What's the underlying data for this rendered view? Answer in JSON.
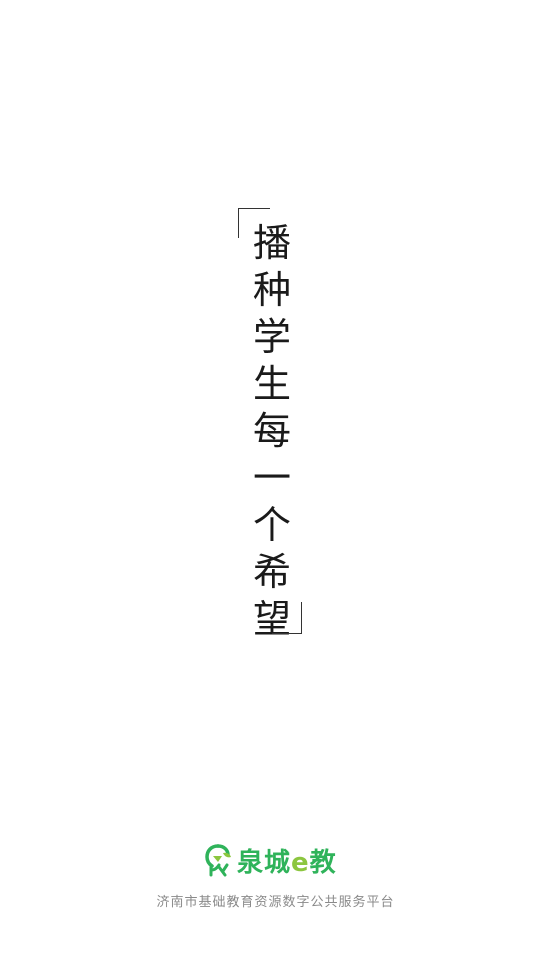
{
  "slogan": {
    "characters": [
      "播",
      "种",
      "学",
      "生",
      "每",
      "一",
      "个",
      "希",
      "望"
    ]
  },
  "brand": {
    "logo_icon": "quancheng-logo-icon",
    "name_part1": "泉城",
    "name_e": "e",
    "name_part2": "教",
    "primary_color": "#2fb35a",
    "accent_color": "#8cc63f"
  },
  "footer": {
    "caption": "济南市基础教育资源数字公共服务平台"
  }
}
